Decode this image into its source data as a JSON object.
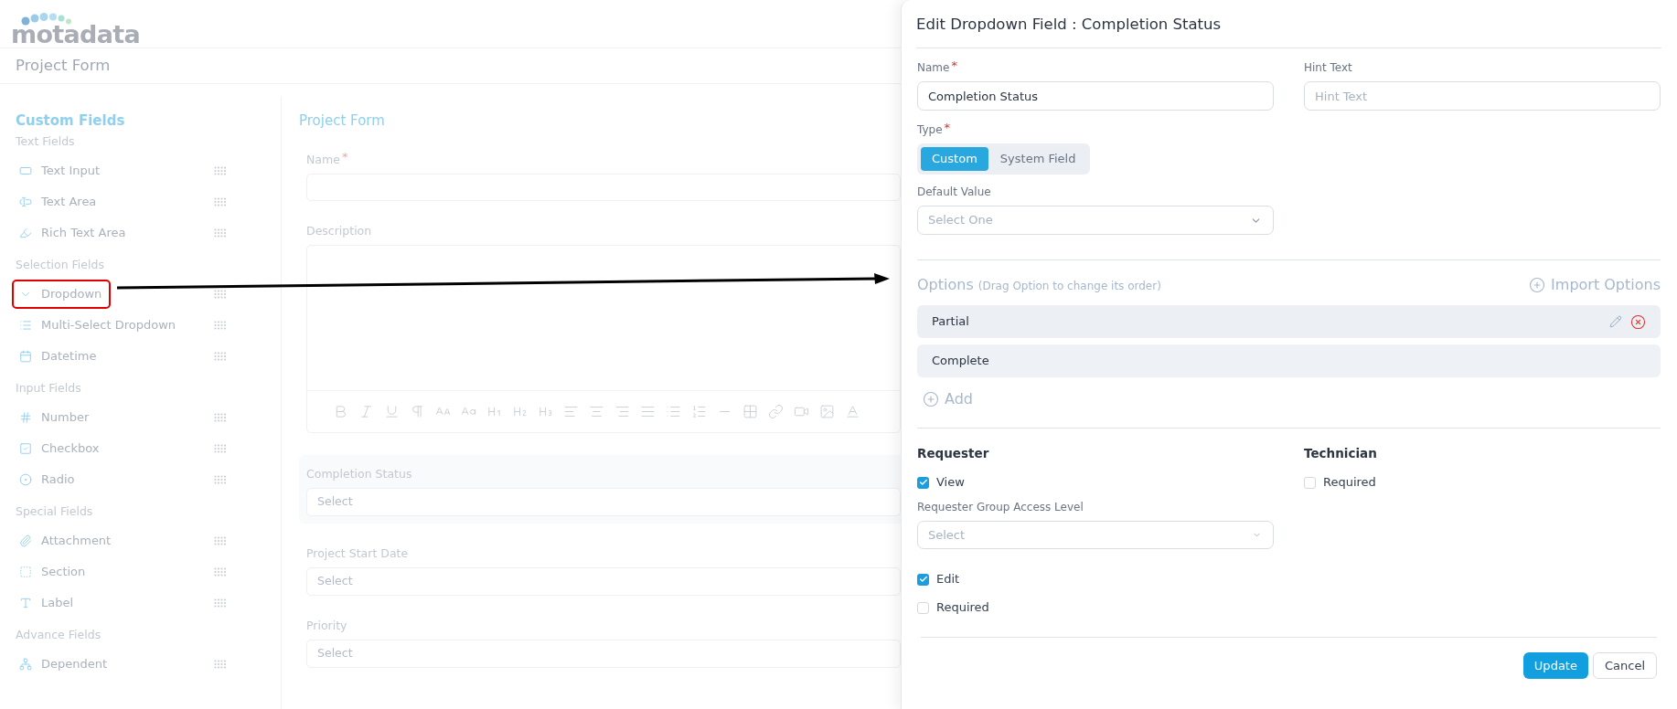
{
  "logo": "motadata",
  "page_title": "Project Form",
  "sidebar": {
    "title": "Custom Fields",
    "groups": [
      {
        "label": "Text Fields",
        "items": [
          {
            "label": "Text Input",
            "kind": "text-input",
            "highlighted": false
          },
          {
            "label": "Text Area",
            "kind": "text-area",
            "highlighted": false
          },
          {
            "label": "Rich Text Area",
            "kind": "rich-text",
            "highlighted": false
          }
        ]
      },
      {
        "label": "Selection Fields",
        "items": [
          {
            "label": "Dropdown",
            "kind": "dropdown",
            "highlighted": true
          },
          {
            "label": "Multi-Select Dropdown",
            "kind": "multi-select",
            "highlighted": false
          },
          {
            "label": "Datetime",
            "kind": "datetime",
            "highlighted": false
          }
        ]
      },
      {
        "label": "Input Fields",
        "items": [
          {
            "label": "Number",
            "kind": "number",
            "highlighted": false
          },
          {
            "label": "Checkbox",
            "kind": "checkbox",
            "highlighted": false
          },
          {
            "label": "Radio",
            "kind": "radio",
            "highlighted": false
          }
        ]
      },
      {
        "label": "Special Fields",
        "items": [
          {
            "label": "Attachment",
            "kind": "attachment",
            "highlighted": false
          },
          {
            "label": "Section",
            "kind": "section",
            "highlighted": false
          },
          {
            "label": "Label",
            "kind": "label",
            "highlighted": false
          }
        ]
      },
      {
        "label": "Advance Fields",
        "items": [
          {
            "label": "Dependent",
            "kind": "dependent",
            "highlighted": false
          }
        ]
      }
    ]
  },
  "form": {
    "title": "Project Form",
    "fields": [
      {
        "label": "Name",
        "kind": "text",
        "required_mark": "*",
        "active": false
      },
      {
        "label": "Description",
        "kind": "rich-text",
        "active": false
      },
      {
        "label": "Completion Status",
        "kind": "select",
        "placeholder": "Select",
        "active": true
      },
      {
        "label": "Project Start Date",
        "kind": "select",
        "placeholder": "Select",
        "active": false
      },
      {
        "label": "Priority",
        "kind": "select",
        "placeholder": "Select",
        "active": false
      }
    ]
  },
  "drawer": {
    "title": "Edit Dropdown Field : Completion Status",
    "name": {
      "label": "Name",
      "required_mark": "*",
      "value": "Completion Status"
    },
    "hint": {
      "label": "Hint Text",
      "placeholder": "Hint Text"
    },
    "type": {
      "label": "Type",
      "required_mark": "*",
      "options": [
        {
          "label": "Custom",
          "selected": true
        },
        {
          "label": "System Field",
          "selected": false
        }
      ]
    },
    "default_value": {
      "label": "Default Value",
      "placeholder": "Select One"
    },
    "options": {
      "title": "Options",
      "note": "(Drag Option to change its order)",
      "import": "Import Options",
      "add": "Add",
      "items": [
        {
          "label": "Partial",
          "hovered": true
        },
        {
          "label": "Complete",
          "hovered": false
        }
      ]
    },
    "requester": {
      "title": "Requester",
      "view": {
        "label": "View",
        "checked": true
      },
      "access_level": {
        "label": "Requester Group Access Level",
        "placeholder": "Select"
      },
      "edit": {
        "label": "Edit",
        "checked": true
      },
      "required": {
        "label": "Required",
        "checked": false
      }
    },
    "technician": {
      "title": "Technician",
      "required": {
        "label": "Required",
        "checked": false
      }
    },
    "buttons": [
      {
        "label": "Update",
        "kind": "primary"
      },
      {
        "label": "Cancel",
        "kind": "secondary"
      }
    ]
  }
}
